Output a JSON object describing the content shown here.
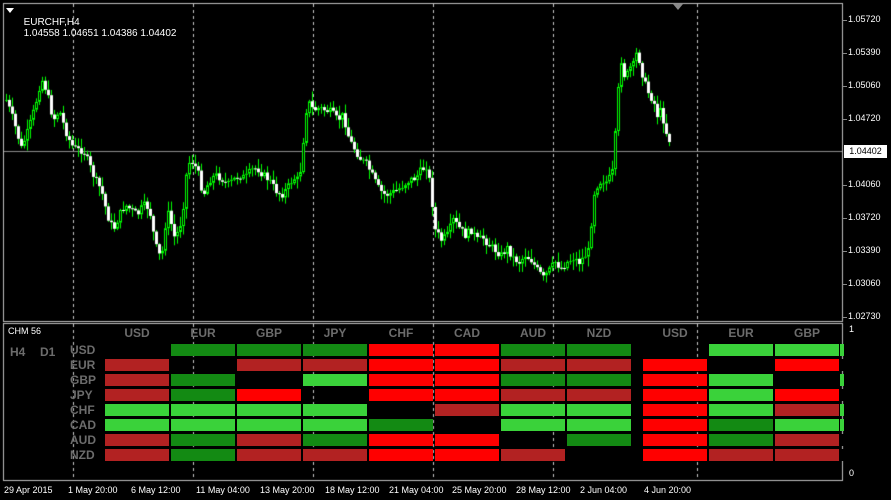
{
  "header": {
    "symbol": "EURCHF,H4",
    "ohlc": "1.04558 1.04651 1.04386 1.04402"
  },
  "price_axis": {
    "labels": [
      "1.05720",
      "1.05390",
      "1.05060",
      "1.04720",
      "1.04060",
      "1.03720",
      "1.03390",
      "1.03060",
      "1.02730"
    ],
    "current_price": "1.04402"
  },
  "time_axis": {
    "labels": [
      "29 Apr 2015",
      "1 May 20:00",
      "6 May 12:00",
      "11 May 04:00",
      "13 May 20:00",
      "18 May 12:00",
      "21 May 04:00",
      "25 May 20:00",
      "28 May 12:00",
      "2 Jun 04:00",
      "4 Jun 20:00"
    ]
  },
  "indicator": {
    "title": "CHM 56",
    "axis_max": "1",
    "axis_min": "0",
    "timeframes": [
      "H4",
      "D1"
    ],
    "columns": [
      "USD",
      "EUR",
      "GBP",
      "JPY",
      "CHF",
      "CAD",
      "AUD",
      "NZD"
    ],
    "columns_right": [
      "USD",
      "EUR",
      "GBP"
    ],
    "rows": [
      "USD",
      "EUR",
      "GBP",
      "JPY",
      "CHF",
      "CAD",
      "AUD",
      "NZD"
    ],
    "colors": {
      "dark_green": "#138a13",
      "light_green": "#3ad23a",
      "red": "#ff0000",
      "dark_red": "#b22222",
      "empty": "#000000"
    },
    "h4_grid": [
      [
        "x",
        "G",
        "G",
        "G",
        "R",
        "R",
        "G",
        "G"
      ],
      [
        "r",
        "x",
        "r",
        "r",
        "R",
        "R",
        "r",
        "r"
      ],
      [
        "r",
        "G",
        "x",
        "g",
        "R",
        "R",
        "G",
        "G"
      ],
      [
        "r",
        "G",
        "R",
        "x",
        "R",
        "R",
        "r",
        "r"
      ],
      [
        "g",
        "g",
        "g",
        "g",
        "x",
        "r",
        "g",
        "g"
      ],
      [
        "g",
        "g",
        "g",
        "g",
        "G",
        "x",
        "g",
        "g"
      ],
      [
        "r",
        "G",
        "r",
        "G",
        "R",
        "R",
        "x",
        "G"
      ],
      [
        "r",
        "G",
        "r",
        "r",
        "R",
        "R",
        "r",
        "x"
      ]
    ],
    "d1_grid": [
      [
        "x",
        "g",
        "g"
      ],
      [
        "R",
        "x",
        "R"
      ],
      [
        "R",
        "g",
        "x"
      ],
      [
        "R",
        "g",
        "R"
      ],
      [
        "R",
        "g",
        "r"
      ],
      [
        "R",
        "G",
        "g"
      ],
      [
        "R",
        "G",
        "r"
      ],
      [
        "R",
        "r",
        "r"
      ]
    ]
  }
}
